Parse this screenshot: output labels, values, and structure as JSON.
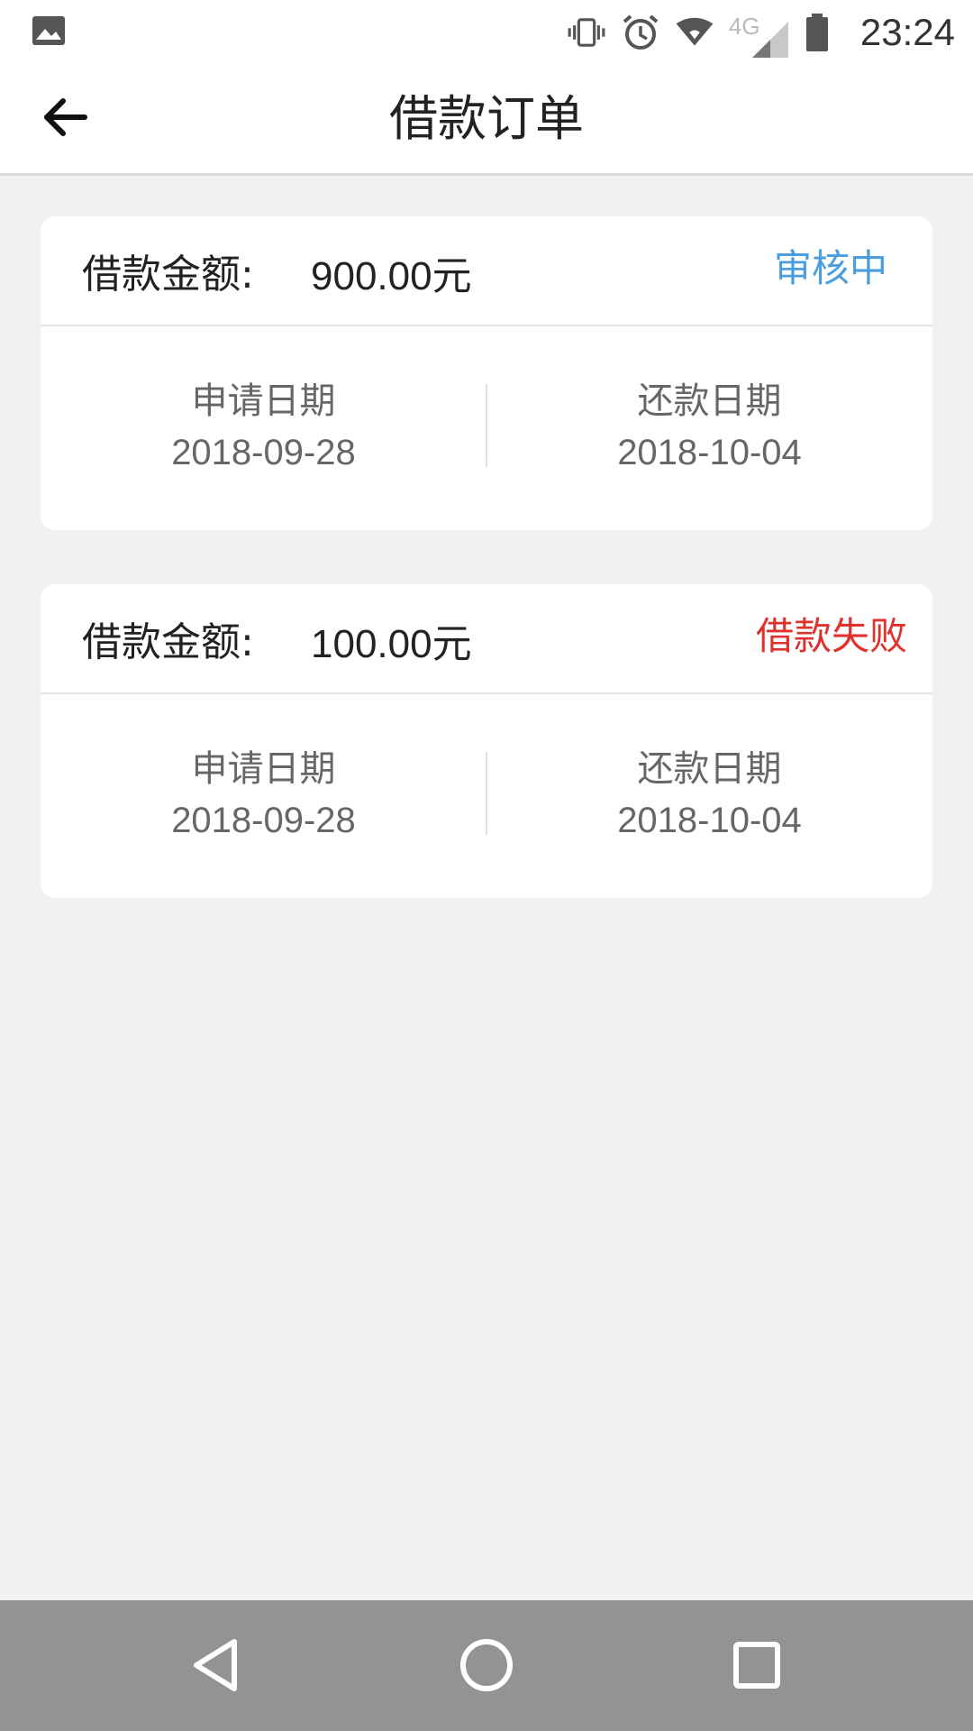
{
  "status_bar": {
    "time": "23:24",
    "network_label": "4G",
    "icons": [
      "image-icon",
      "vibrate-icon",
      "alarm-icon",
      "wifi-icon",
      "signal-icon",
      "battery-icon"
    ]
  },
  "app_bar": {
    "title": "借款订单"
  },
  "orders": [
    {
      "amount_label": "借款金额:",
      "amount_value": "900.00元",
      "status": "审核中",
      "status_color": "#4a9ee0",
      "apply_label": "申请日期",
      "apply_date": "2018-09-28",
      "repay_label": "还款日期",
      "repay_date": "2018-10-04"
    },
    {
      "amount_label": "借款金额:",
      "amount_value": "100.00元",
      "status": "借款失败",
      "status_color": "#e0322d",
      "apply_label": "申请日期",
      "apply_date": "2018-09-28",
      "repay_label": "还款日期",
      "repay_date": "2018-10-04"
    }
  ],
  "nav_bar": {
    "icons": [
      "back-triangle-icon",
      "home-circle-icon",
      "recents-square-icon"
    ]
  }
}
